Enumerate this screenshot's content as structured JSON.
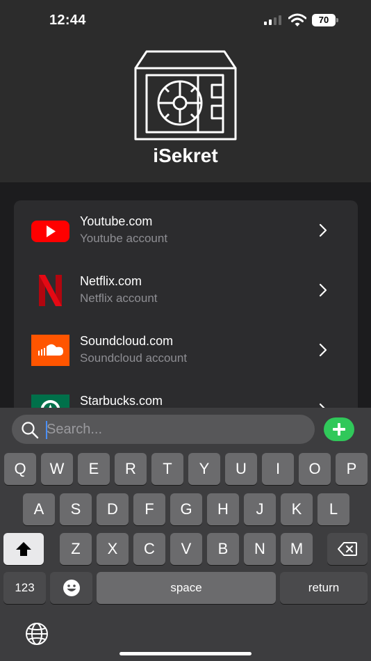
{
  "status_bar": {
    "time": "12:44",
    "battery": "70",
    "cellular_icon": "cellular-signal-icon",
    "wifi_icon": "wifi-icon"
  },
  "header": {
    "logo_icon": "safe-vault-icon",
    "app_title": "iSekret"
  },
  "accounts": [
    {
      "title": "Youtube.com",
      "subtitle": "Youtube account",
      "icon": "youtube-logo-icon"
    },
    {
      "title": "Netflix.com",
      "subtitle": "Netflix account",
      "icon": "netflix-logo-icon"
    },
    {
      "title": "Soundcloud.com",
      "subtitle": "Soundcloud account",
      "icon": "soundcloud-logo-icon"
    },
    {
      "title": "Starbucks.com",
      "subtitle": "",
      "icon": "starbucks-logo-icon"
    }
  ],
  "search": {
    "placeholder": "Search...",
    "value": ""
  },
  "keyboard": {
    "row1": [
      "Q",
      "W",
      "E",
      "R",
      "T",
      "Y",
      "U",
      "I",
      "O",
      "P"
    ],
    "row2": [
      "A",
      "S",
      "D",
      "F",
      "G",
      "H",
      "J",
      "K",
      "L"
    ],
    "row3": [
      "Z",
      "X",
      "C",
      "V",
      "B",
      "N",
      "M"
    ],
    "numbers_label": "123",
    "space_label": "space",
    "return_label": "return"
  },
  "colors": {
    "header_bg": "#2c2c2c",
    "card_bg": "#2c2c2e",
    "keyboard_bg": "#3d3d3f",
    "add_button": "#30c85a",
    "youtube_red": "#ff0000",
    "netflix_red": "#e50914",
    "soundcloud_orange": "#ff5500",
    "starbucks_green": "#00704a"
  }
}
